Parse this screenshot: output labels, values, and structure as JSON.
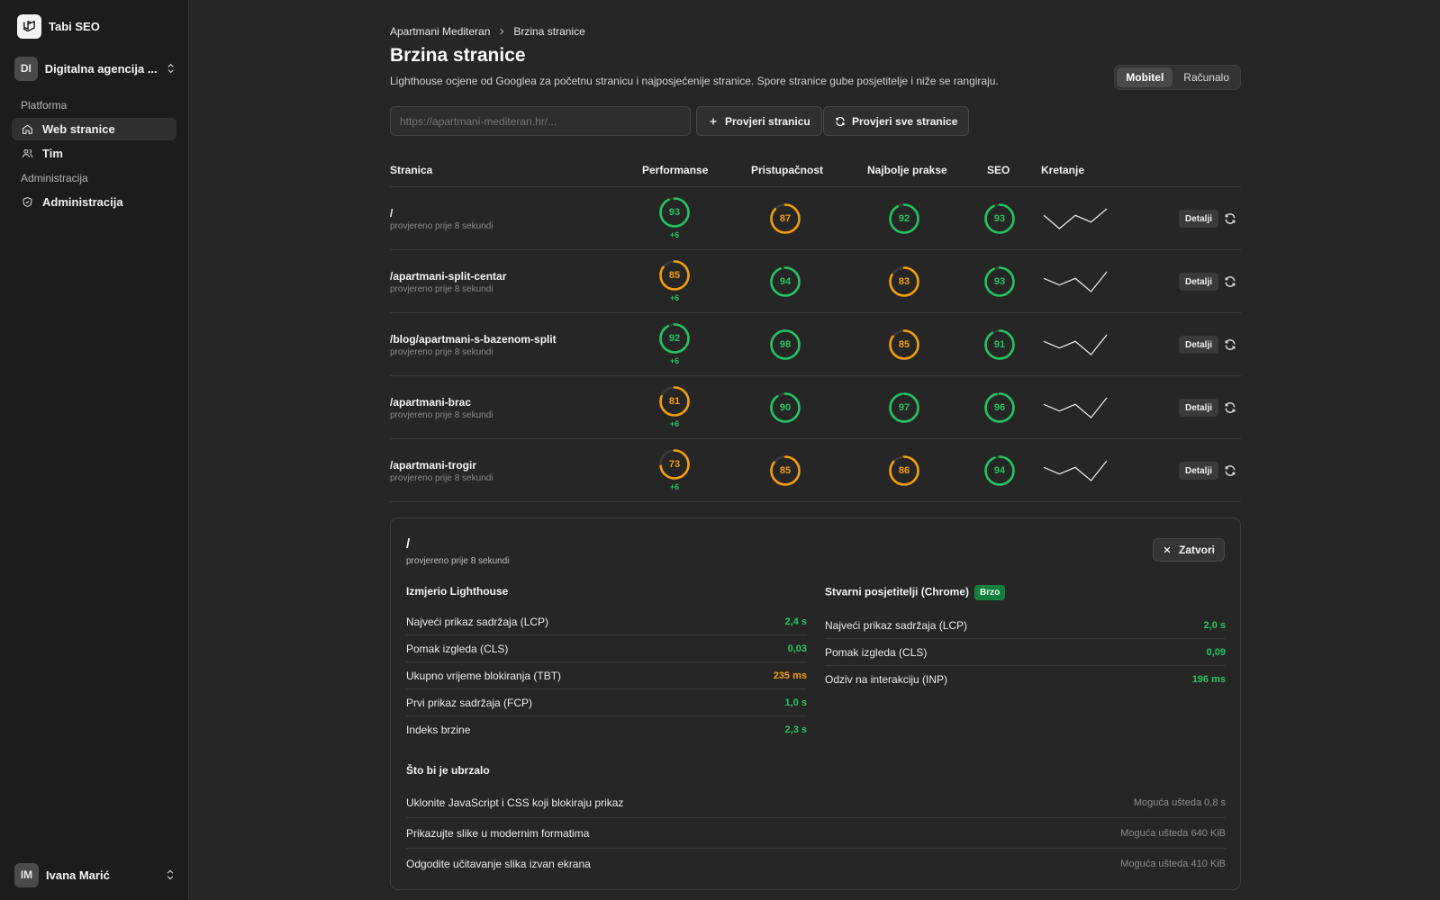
{
  "app": {
    "name": "Tabi SEO"
  },
  "team": {
    "initials": "DI",
    "name": "Digitalna agencija ..."
  },
  "sidebar": {
    "group_platform": "Platforma",
    "group_admin": "Administracija",
    "items": [
      {
        "label": "Web stranice",
        "icon": "home-icon",
        "active": true
      },
      {
        "label": "Tim",
        "icon": "users-icon",
        "active": false
      },
      {
        "label": "Administracija",
        "icon": "shield-icon",
        "active": false
      }
    ]
  },
  "user": {
    "initials": "IM",
    "name": "Ivana Marić"
  },
  "breadcrumb": {
    "site": "Apartmani Mediteran",
    "current": "Brzina stranice"
  },
  "page": {
    "title": "Brzina stranice",
    "description": "Lighthouse ocjene od Googlea za početnu stranicu i najposjećenije stranice. Spore stranice gube posjetitelje i niže se rangiraju."
  },
  "device_toggle": {
    "mobile": "Mobitel",
    "desktop": "Računalo",
    "selected": "Mobitel"
  },
  "url_input": {
    "placeholder": "https://apartmani-mediteran.hr/...",
    "value": ""
  },
  "actions": {
    "check_page": "Provjeri stranicu",
    "check_all": "Provjeri sve stranice"
  },
  "table": {
    "headers": [
      "Stranica",
      "Performanse",
      "Pristupačnost",
      "Najbolje prakse",
      "SEO",
      "Kretanje"
    ],
    "details_label": "Detalji",
    "rows": [
      {
        "path": "/",
        "checked": "provjereno prije 8 sekundi",
        "performance": 93,
        "delta": "+6",
        "accessibility": 87,
        "best_practices": 92,
        "seo": 93,
        "trend": [
          3,
          1,
          3,
          2,
          4
        ]
      },
      {
        "path": "/apartmani-split-centar",
        "checked": "provjereno prije 8 sekundi",
        "performance": 85,
        "delta": "+6",
        "accessibility": 94,
        "best_practices": 83,
        "seo": 93,
        "trend": [
          3,
          2,
          3,
          1,
          4
        ]
      },
      {
        "path": "/blog/apartmani-s-bazenom-split",
        "checked": "provjereno prije 8 sekundi",
        "performance": 92,
        "delta": "+6",
        "accessibility": 98,
        "best_practices": 85,
        "seo": 91,
        "trend": [
          3,
          2,
          3,
          1,
          4
        ]
      },
      {
        "path": "/apartmani-brac",
        "checked": "provjereno prije 8 sekundi",
        "performance": 81,
        "delta": "+6",
        "accessibility": 90,
        "best_practices": 97,
        "seo": 96,
        "trend": [
          3,
          2,
          3,
          1,
          4
        ]
      },
      {
        "path": "/apartmani-trogir",
        "checked": "provjereno prije 8 sekundi",
        "performance": 73,
        "delta": "+6",
        "accessibility": 85,
        "best_practices": 86,
        "seo": 94,
        "trend": [
          3,
          2,
          3,
          1,
          4
        ]
      }
    ]
  },
  "details": {
    "path": "/",
    "checked": "provjereno prije 8 sekundi",
    "close_label": "Zatvori",
    "lab_title": "Izmjerio Lighthouse",
    "lab_metrics": [
      {
        "label": "Najveći prikaz sadržaja (LCP)",
        "value": "2,4 s",
        "status": "good"
      },
      {
        "label": "Pomak izgleda (CLS)",
        "value": "0,03",
        "status": "good"
      },
      {
        "label": "Ukupno vrijeme blokiranja (TBT)",
        "value": "235 ms",
        "status": "average"
      },
      {
        "label": "Prvi prikaz sadržaja (FCP)",
        "value": "1,0 s",
        "status": "good"
      },
      {
        "label": "Indeks brzine",
        "value": "2,3 s",
        "status": "good"
      }
    ],
    "field_title": "Stvarni posjetitelji (Chrome)",
    "field_badge": "Brzo",
    "field_metrics": [
      {
        "label": "Najveći prikaz sadržaja (LCP)",
        "value": "2,0 s",
        "status": "good"
      },
      {
        "label": "Pomak izgleda (CLS)",
        "value": "0,09",
        "status": "good"
      },
      {
        "label": "Odziv na interakciju (INP)",
        "value": "196 ms",
        "status": "good"
      }
    ],
    "suggestions_title": "Što bi je ubrzalo",
    "suggestions": [
      {
        "label": "Uklonite JavaScript i CSS koji blokiraju prikaz",
        "saving": "Moguća ušteda 0,8 s"
      },
      {
        "label": "Prikazujte slike u modernim formatima",
        "saving": "Moguća ušteda 640 KiB"
      },
      {
        "label": "Odgodite učitavanje slika izvan ekrana",
        "saving": "Moguća ušteda 410 KiB"
      }
    ]
  },
  "colors": {
    "good": "#22c55e",
    "average": "#f59e0b",
    "track": "#3a3a3a"
  }
}
